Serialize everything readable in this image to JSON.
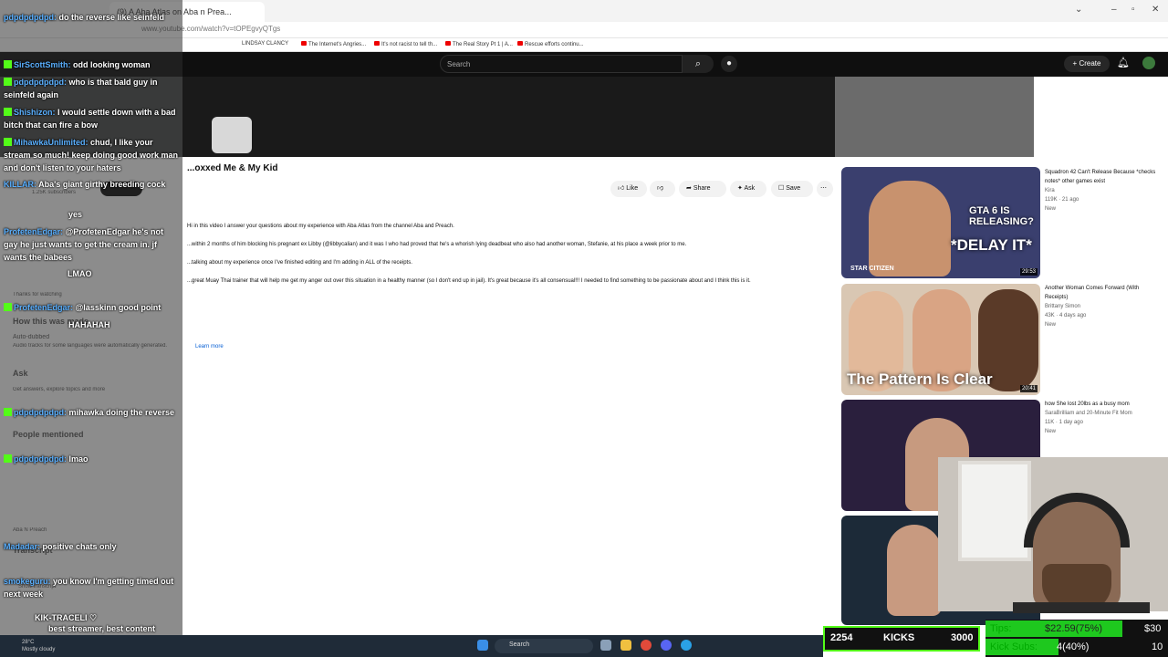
{
  "browser": {
    "tab_title": "(9) A Aba Atlas on Aba n Prea...",
    "url": "www.youtube.com/watch?v=tOPEgvyQTgs",
    "bookmarks": [
      "LINDSAY CLANCY",
      "The Internet's Angries...",
      "It's not racist to tell th...",
      "The Real Story Pt 1 | A...",
      "Rescue efforts continu..."
    ]
  },
  "youtube": {
    "search_placeholder": "Search",
    "create_label": "+ Create",
    "video_title": "...oxxed Me & My Kid",
    "actions": {
      "like": "Like",
      "share": "Share",
      "ask": "Ask",
      "save": "Save"
    },
    "description_lines": [
      "Hi in this video I answer your questions about my experience with Aba Atlas from the channel Aba and Preach.",
      "...within 2 months of him blocking his pregnant ex Libby (@libbycalian) and it was I who had proved that he's a whorish lying deadbeat who also had another woman, Stefanie, at his place a week prior to me.",
      "...talking about my experience once I've finished editing and I'm adding in ALL of the receipts.",
      "...great Muay Thai trainer that will help me get my anger out over this situation in a healthy manner (so I don't end up in jail). It's great because it's all consensual!!! I needed to find something to be passionate about and I think this is it."
    ],
    "learn_more": "Learn more",
    "related": [
      {
        "title": "Squadron 42 Can't Release Because *checks notes* other games exist",
        "channel": "Kira",
        "meta": "119K · 21 ago",
        "badge": "New",
        "duration": "29:53",
        "overlay1": "GTA 6 IS RELEASING?",
        "overlay2": "*DELAY IT*",
        "overlay3": "STAR CITIZEN"
      },
      {
        "title": "Another Woman Comes Forward (With Receipts)",
        "channel": "Brittany Simon",
        "meta": "43K · 4 days ago",
        "badge": "New",
        "duration": "20:41",
        "overlay1": "The Pattern Is Clear"
      },
      {
        "title": "how She lost 20lbs as a busy mom",
        "channel": "SaraBrilliam and 20-Minute Fit Mom",
        "meta": "11K · 1 day ago",
        "badge": "New"
      },
      {
        "title": "",
        "channel": "",
        "meta": "",
        "badge": ""
      }
    ]
  },
  "chat": [
    {
      "user": "pdpdpdpdpd:",
      "msg": "do the reverse like seinfeld"
    },
    {
      "user": "SirScottSmith:",
      "msg": "odd looking woman"
    },
    {
      "user": "pdpdpdpdpd:",
      "msg": "who is that bald guy in seinfeld again"
    },
    {
      "user": "Shishizon:",
      "msg": "I would settle down with a bad bitch that can fire a bow"
    },
    {
      "user": "MihawkaUnlimited:",
      "msg": "chud, I like your stream so much! keep doing good work man and don't listen to your haters"
    },
    {
      "user": "KILLAR:",
      "msg": "Aba's giant girthy breeding cock"
    },
    {
      "user": "",
      "msg": "yes"
    },
    {
      "user": "ProfetenEdgar:",
      "msg": "@ProfetenEdgar he's not gay he just wants to get the cream in. jf wants the babees"
    },
    {
      "user": "",
      "msg": "LMAO"
    },
    {
      "user": "ProfetenEdgar:",
      "msg": "@lasskinn good point"
    },
    {
      "user": "",
      "msg": "HAHAHAH"
    },
    {
      "user": "pdpdpdpdpd:",
      "msg": "mihawka doing the reverse"
    },
    {
      "user": "pdpdpdpdpd:",
      "msg": "lmao"
    },
    {
      "user": "Madadar:",
      "msg": "positive chats only"
    },
    {
      "user": "smokeguru:",
      "msg": "you know I'm getting timed out next week"
    },
    {
      "user": "",
      "msg": "KIK-TRACELI ♡"
    },
    {
      "user": "",
      "msg": "best streamer, best content"
    }
  ],
  "ghost_text": {
    "how_made": "How this was made",
    "auto_dubbed": "Auto-dubbed",
    "auto_note": "Audio tracks for some languages were automatically generated.",
    "ask": "Ask",
    "ask_sub": "Get answers, explore topics and more",
    "people": "People mentioned",
    "aba": "Aba N Preach",
    "transcript": "Transcript",
    "show_transcript": "Show transcript",
    "subscribers": "1.25K subscribers",
    "thanks": "Thanks for watching"
  },
  "stats": {
    "kicks_count": "2254",
    "kicks_label": "KICKS",
    "kicks_goal": "3000",
    "tips_label": "Tips:",
    "tips_value": "$22.59(75%)",
    "tips_goal": "$30",
    "subs_label": "Kick Subs:",
    "subs_value": "4(40%)",
    "subs_goal": "10"
  },
  "taskbar": {
    "search": "Search",
    "weather_temp": "28°C",
    "weather_desc": "Mostly cloudy"
  },
  "colors": {
    "kick_green": "#53fc18",
    "youtube_dark": "#0f0f0f",
    "link_blue": "#065fd4"
  }
}
